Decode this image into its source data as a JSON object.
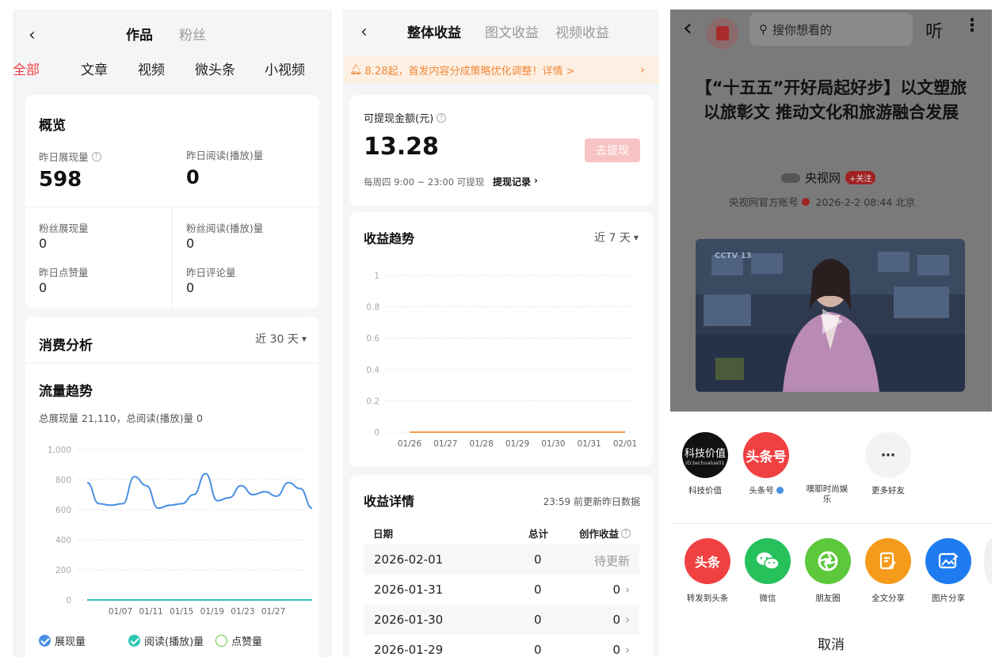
{
  "panel1": {
    "header_tabs": [
      "作品",
      "粉丝"
    ],
    "sub_tabs": [
      "全部",
      "文章",
      "视频",
      "微头条",
      "小视频"
    ],
    "overview": {
      "title": "概览",
      "yesterday_impressions_label": "昨日展现量",
      "yesterday_impressions_value": "598",
      "yesterday_reads_label": "昨日阅读(播放)量",
      "yesterday_reads_value": "0",
      "fan_impressions_label": "粉丝展现量",
      "fan_impressions_value": "0",
      "fan_reads_label": "粉丝阅读(播放)量",
      "fan_reads_value": "0",
      "yesterday_likes_label": "昨日点赞量",
      "yesterday_likes_value": "0",
      "yesterday_comments_label": "昨日评论量",
      "yesterday_comments_value": "0"
    },
    "consumption": {
      "title": "消费分析",
      "period": "近 30 天"
    },
    "traffic": {
      "title": "流量趋势",
      "summary": "总展现量 21,110，总阅读(播放)量 0",
      "legend": [
        "展现量",
        "阅读(播放)量",
        "点赞量"
      ]
    }
  },
  "panel2": {
    "header_tabs": [
      "整体收益",
      "图文收益",
      "视频收益"
    ],
    "notice": "8.28起，首发内容分成策略优化调整！详情 >",
    "withdraw": {
      "label": "可提现金额(元)",
      "amount": "13.28",
      "button": "去提现",
      "schedule": "每周四 9:00 ~ 23:00 可提现",
      "record_link": "提现记录"
    },
    "trend": {
      "title": "收益趋势",
      "period": "近 7 天"
    },
    "details": {
      "title": "收益详情",
      "update_note": "23:59 前更新昨日数据",
      "columns": [
        "日期",
        "总计",
        "创作收益"
      ],
      "rows": [
        {
          "date": "2026-02-01",
          "total": "0",
          "creation": "待更新"
        },
        {
          "date": "2026-01-31",
          "total": "0",
          "creation": "0"
        },
        {
          "date": "2026-01-30",
          "total": "0",
          "creation": "0"
        },
        {
          "date": "2026-01-29",
          "total": "0",
          "creation": "0"
        }
      ]
    }
  },
  "panel3": {
    "search_placeholder": "搜你想看的",
    "listen_label": "听",
    "article_title": "【“十五五”开好局起好步】以文塑旅 以旅彰文 推动文化和旅游融合发展",
    "author": "央视网",
    "follow_label": "+关注",
    "meta": "央视网官方账号",
    "meta_time": "2026-2-2 08:44 北京",
    "video_channel_logo": "CCTV 13",
    "contacts": [
      {
        "name": "科技价值",
        "avatar_text": "科技价值",
        "avatar_sub": "ID:techvalue01"
      },
      {
        "name": "头条号",
        "avatar_text": "头条号"
      },
      {
        "name": "噢耶时尚娱乐"
      },
      {
        "name": "更多好友"
      }
    ],
    "share_targets": [
      "转发到头条",
      "微信",
      "朋友圈",
      "全文分享",
      "图片分享"
    ],
    "share_toutiao_icon_text": "头条",
    "cancel": "取消"
  },
  "chart_data": [
    {
      "type": "line",
      "title": "流量趋势",
      "x": [
        "01/07",
        "01/11",
        "01/15",
        "01/19",
        "01/23",
        "01/27"
      ],
      "ylim": [
        0,
        1000
      ],
      "yticks": [
        0,
        200,
        400,
        600,
        800,
        1000
      ],
      "series": [
        {
          "name": "展现量",
          "values": [
            780,
            640,
            630,
            640,
            820,
            760,
            610,
            630,
            640,
            700,
            840,
            660,
            680,
            760,
            700,
            720,
            690,
            780,
            740,
            610
          ]
        },
        {
          "name": "阅读(播放)量",
          "values": [
            0,
            0,
            0,
            0,
            0,
            0,
            0,
            0,
            0,
            0,
            0,
            0,
            0,
            0,
            0,
            0,
            0,
            0,
            0,
            0
          ]
        }
      ],
      "legend": "bottom",
      "grid": true
    },
    {
      "type": "line",
      "title": "收益趋势",
      "x": [
        "01/26",
        "01/27",
        "01/28",
        "01/29",
        "01/30",
        "01/31",
        "02/01"
      ],
      "ylim": [
        0,
        1
      ],
      "yticks": [
        0,
        0.2,
        0.4,
        0.6,
        0.8,
        1
      ],
      "series": [
        {
          "values": [
            0,
            0,
            0,
            0,
            0,
            0,
            0
          ]
        }
      ],
      "grid": true
    }
  ],
  "colors": {
    "accent_red": "#f04142",
    "chart_blue": "#4a90e2",
    "chart_teal": "#2bc5b4",
    "chart_orange": "#f59a4a",
    "notice_bg": "#fdf0e3",
    "wechat_green": "#27c15c",
    "moments_green": "#5cc83c",
    "fulltext_orange": "#f59a1b",
    "image_blue": "#1e7cf0"
  }
}
